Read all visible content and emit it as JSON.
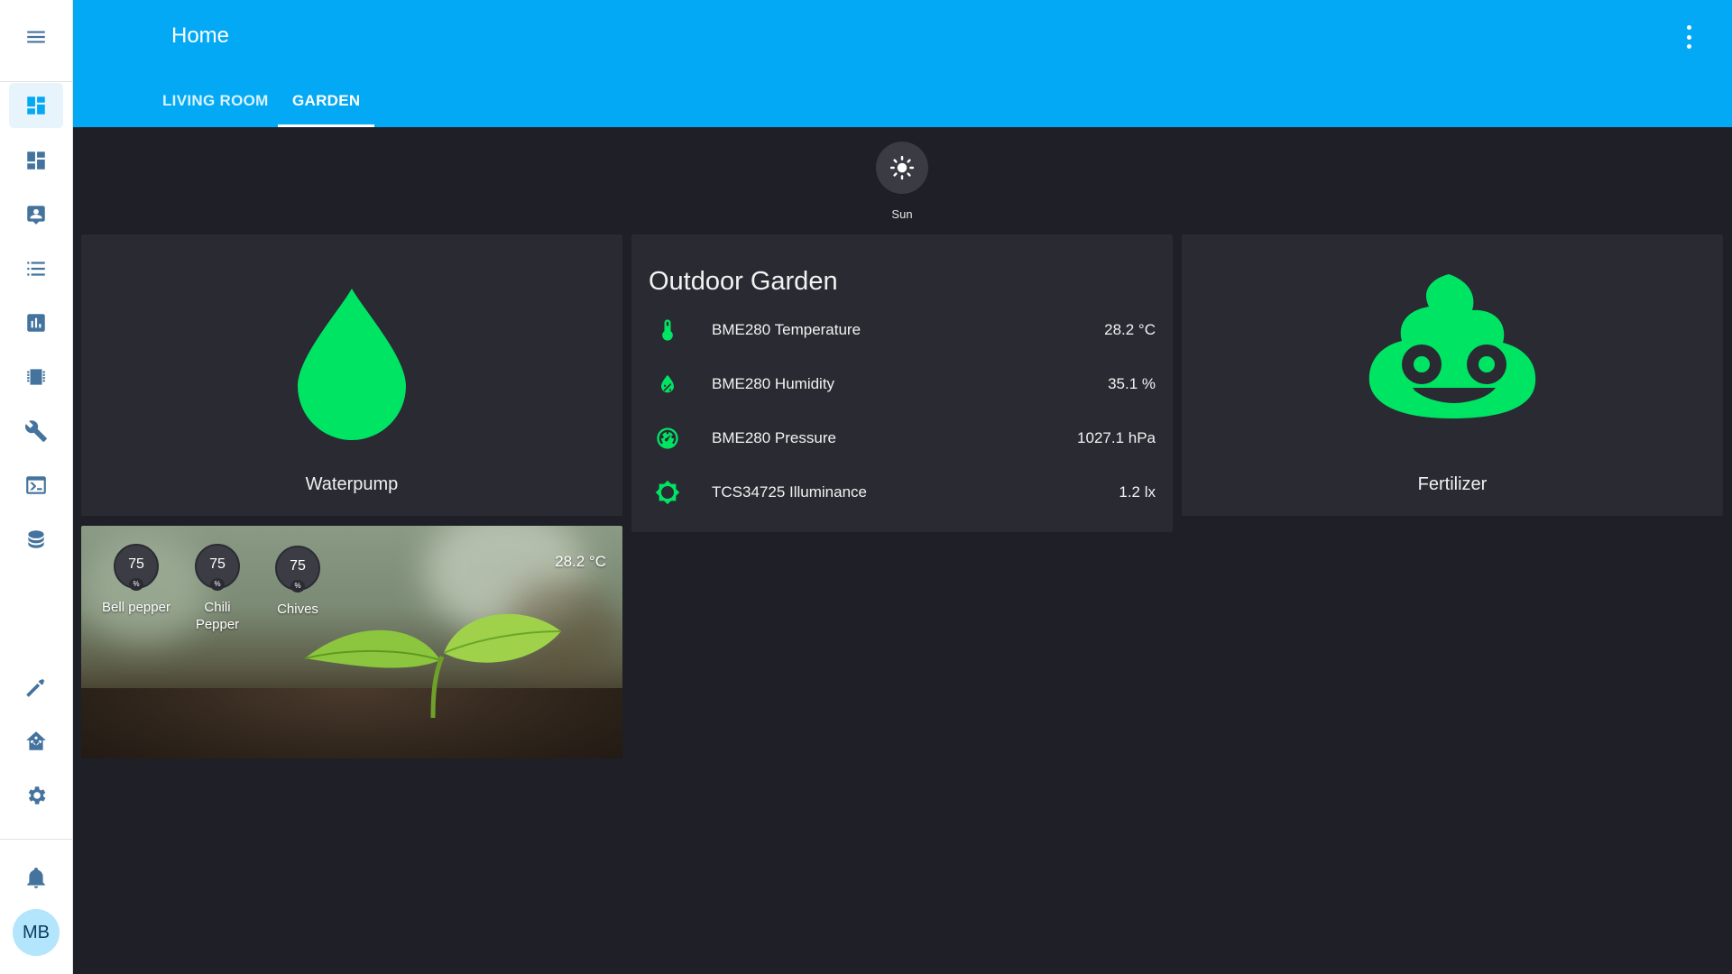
{
  "header": {
    "title": "Home",
    "tabs": [
      {
        "label": "LIVING ROOM",
        "active": false
      },
      {
        "label": "GARDEN",
        "active": true
      }
    ]
  },
  "sidebar": {
    "items": [
      {
        "icon": "menu-icon"
      },
      {
        "icon": "dashboard-icon",
        "active": true
      },
      {
        "icon": "dashboard-icon"
      },
      {
        "icon": "account-box-icon"
      },
      {
        "icon": "list-icon"
      },
      {
        "icon": "chart-bar-icon"
      },
      {
        "icon": "chip-icon"
      },
      {
        "icon": "wrench-icon"
      },
      {
        "icon": "console-icon"
      },
      {
        "icon": "database-icon"
      },
      {
        "icon": "hammer-icon"
      },
      {
        "icon": "home-assistant-icon"
      },
      {
        "icon": "gear-icon"
      },
      {
        "icon": "bell-icon"
      }
    ],
    "user_initials": "MB"
  },
  "badge": {
    "icon": "sun-icon",
    "label": "Sun"
  },
  "cards": {
    "waterpump": {
      "label": "Waterpump",
      "icon": "water-drop-icon",
      "color": "#00e463"
    },
    "fertilizer": {
      "label": "Fertilizer",
      "icon": "poo-icon",
      "color": "#00e463"
    },
    "outdoor": {
      "title": "Outdoor Garden",
      "entities": [
        {
          "icon": "thermometer-icon",
          "name": "BME280 Temperature",
          "value": "28.2 °C"
        },
        {
          "icon": "water-percent-icon",
          "name": "BME280 Humidity",
          "value": "35.1 %"
        },
        {
          "icon": "gauge-icon",
          "name": "BME280 Pressure",
          "value": "1027.1 hPa"
        },
        {
          "icon": "brightness-icon",
          "name": "TCS34725 Illuminance",
          "value": "1.2 lx"
        }
      ]
    },
    "picture": {
      "temperature": "28.2 °C",
      "gauges": [
        {
          "value": "75",
          "unit": "%",
          "name": "Bell pepper"
        },
        {
          "value": "75",
          "unit": "%",
          "name": "Chili Pepper"
        },
        {
          "value": "75",
          "unit": "%",
          "name": "Chives"
        }
      ]
    }
  },
  "colors": {
    "accent": "#03a9f4",
    "icon_green": "#00e463",
    "sidebar_icon": "#44739e"
  }
}
